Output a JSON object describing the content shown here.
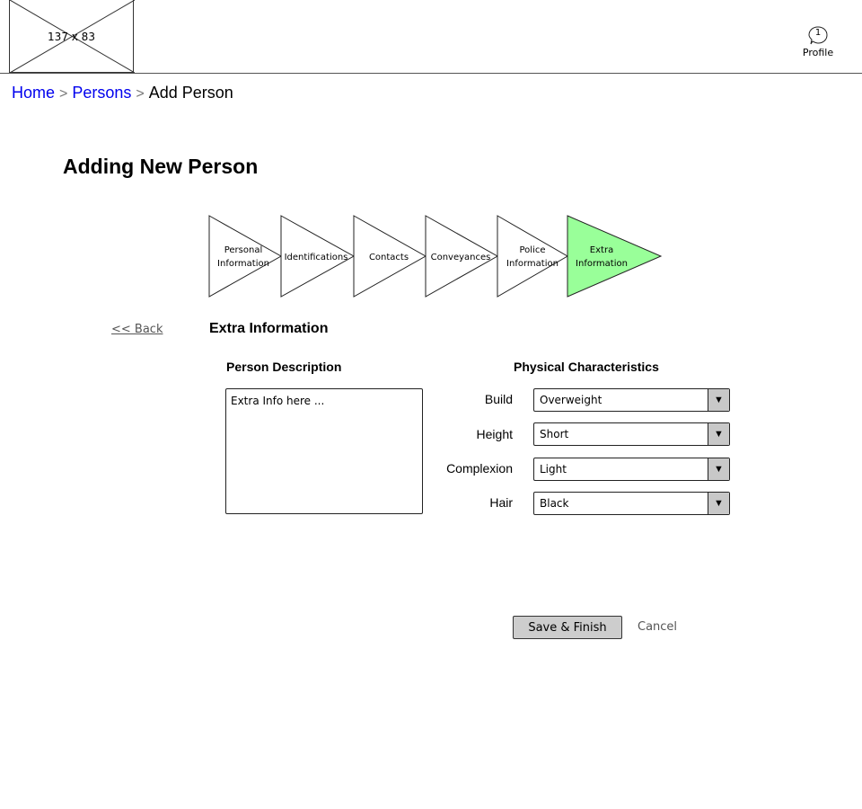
{
  "header": {
    "logo_placeholder": "137 x 83",
    "profile_badge": "1",
    "profile_label": "Profile"
  },
  "breadcrumb": {
    "items": [
      "Home",
      "Persons",
      "Add Person"
    ],
    "separator": ">"
  },
  "page": {
    "title": "Adding New Person"
  },
  "wizard": {
    "steps": [
      {
        "label": "Personal\nInformation",
        "active": false
      },
      {
        "label": "Identifications",
        "active": false
      },
      {
        "label": "Contacts",
        "active": false
      },
      {
        "label": "Conveyances",
        "active": false
      },
      {
        "label": "Police\nInformation",
        "active": false
      },
      {
        "label": "Extra\nInformation",
        "active": true
      }
    ],
    "active_color": "#99ff99"
  },
  "nav": {
    "back_label": "<< Back"
  },
  "section": {
    "title": "Extra Information",
    "description_heading": "Person Description",
    "description_value": "Extra Info here ...",
    "physical_heading": "Physical Characteristics",
    "fields": [
      {
        "label": "Build",
        "value": "Overweight"
      },
      {
        "label": "Height",
        "value": "Short"
      },
      {
        "label": "Complexion",
        "value": "Light"
      },
      {
        "label": "Hair",
        "value": "Black"
      }
    ]
  },
  "actions": {
    "save_label": "Save & Finish",
    "cancel_label": "Cancel"
  }
}
